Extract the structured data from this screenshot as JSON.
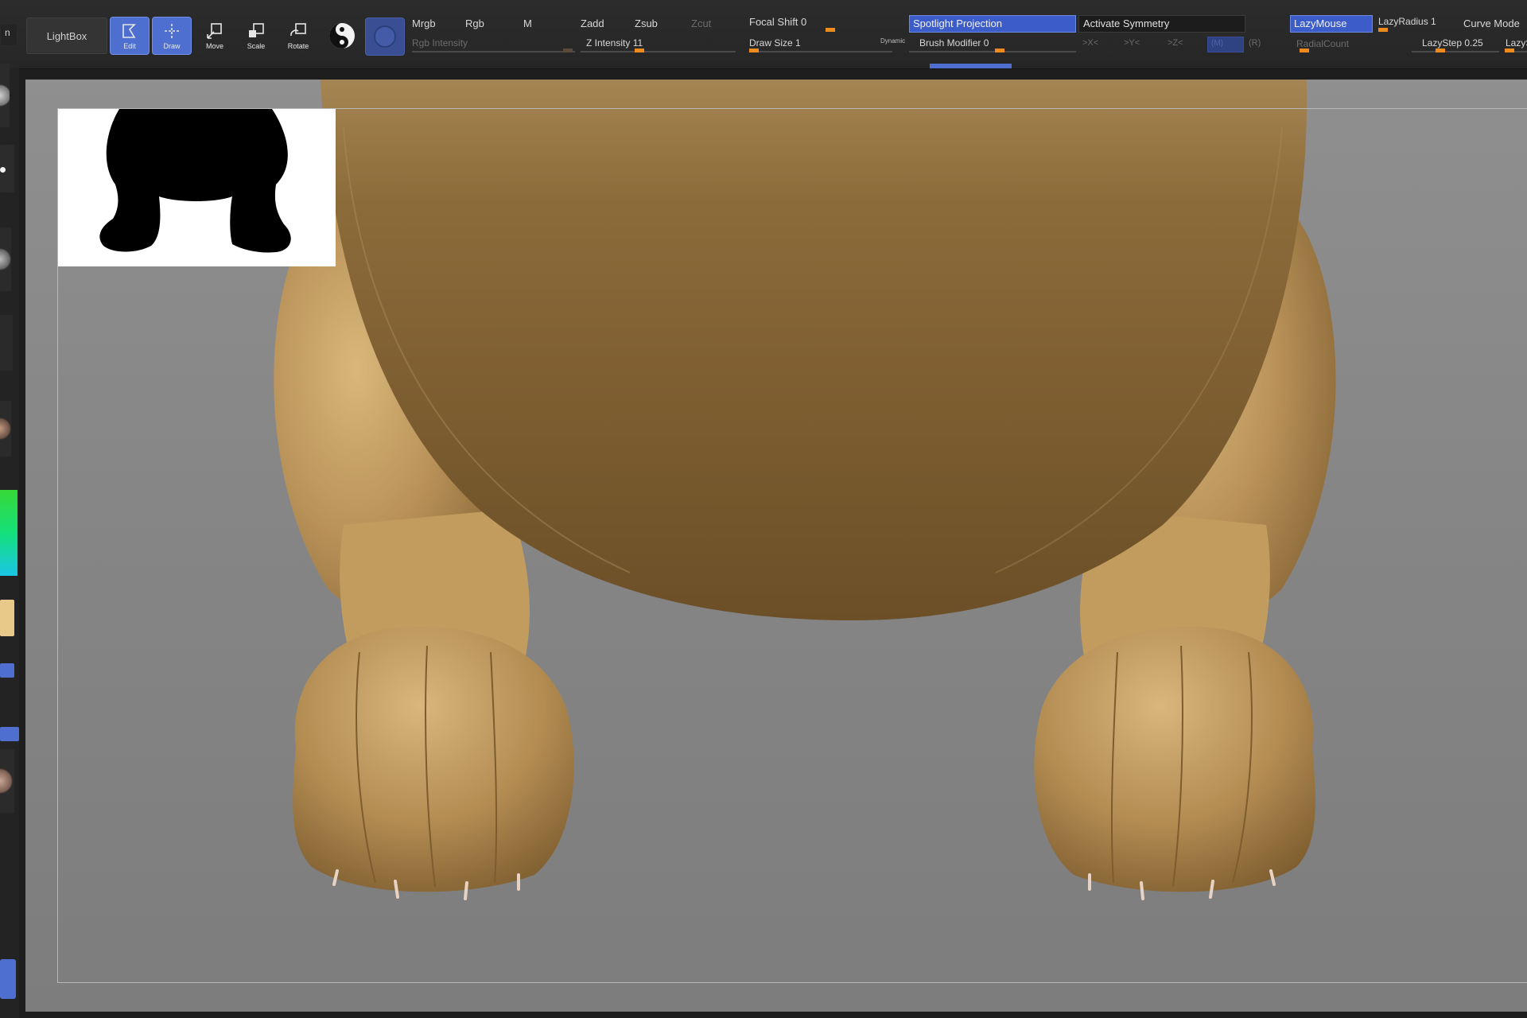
{
  "toolbar": {
    "lightbox_label": "LightBox",
    "tools": {
      "edit": "Edit",
      "draw": "Draw",
      "move": "Move",
      "scale": "Scale",
      "rotate": "Rotate"
    },
    "mrgb": "Mrgb",
    "rgb": "Rgb",
    "m": "M",
    "rgb_intensity": "Rgb Intensity",
    "zadd": "Zadd",
    "zsub": "Zsub",
    "zcut": "Zcut",
    "z_intensity": "Z Intensity 11",
    "z_intensity_value": 0.35,
    "focal_shift": "Focal Shift 0",
    "focal_shift_value": 0.5,
    "draw_size": "Draw Size 1",
    "draw_size_value": 0.02,
    "dynamic": "Dynamic",
    "spotlight_projection": "Spotlight Projection",
    "activate_symmetry": "Activate Symmetry",
    "brush_modifier": "Brush Modifier 0",
    "x_axis": ">X<",
    "y_axis": ">Y<",
    "z_axis": ">Z<",
    "m_axis": "(M)",
    "r_axis": "(R)",
    "radial_count": "RadialCount",
    "lazymouse": "LazyMouse",
    "lazyradius": "LazyRadius 1",
    "lazystep": "LazyStep 0.25",
    "lazysnap": "LazyS",
    "curve_mode": "Curve Mode"
  },
  "colors": {
    "accent_blue": "#4e6fd0",
    "slider_orange": "#ef8a1c",
    "model_base": "#b08a4a",
    "viewport_bg": "#888888"
  }
}
